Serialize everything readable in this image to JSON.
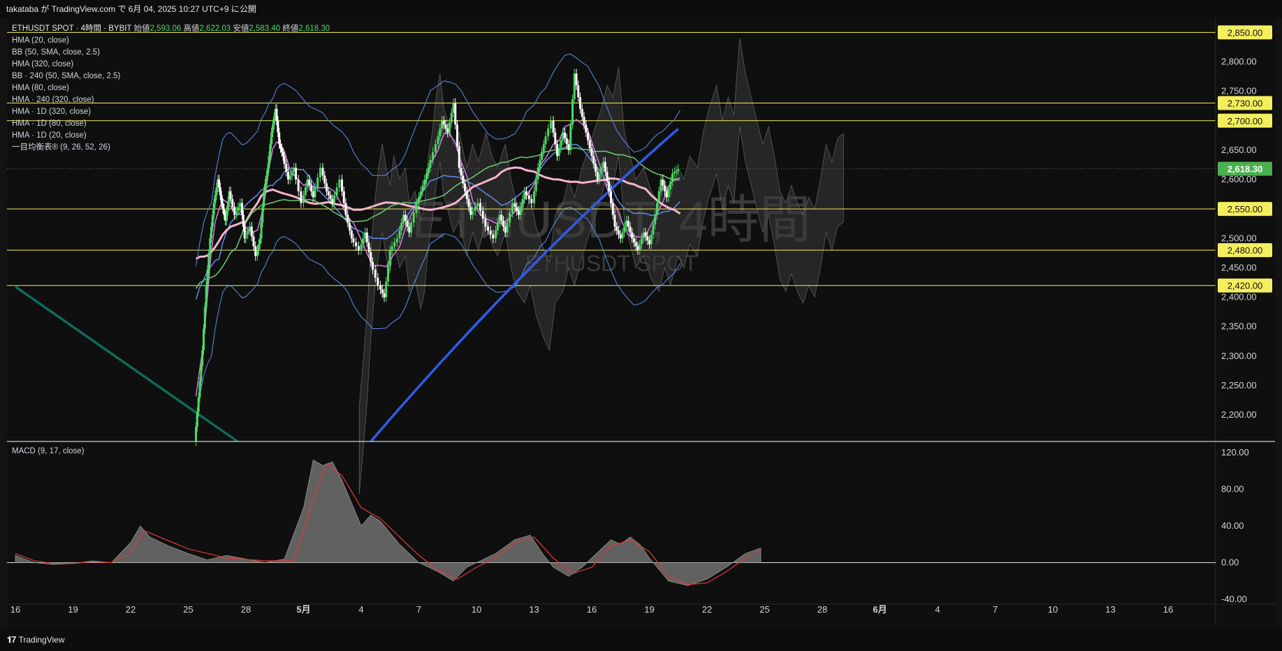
{
  "header": {
    "publish_line": "takataba が TradingView.com で 6月 04, 2025 10:27 UTC+9 に公開"
  },
  "legend": {
    "symbol": "ETHUSDT SPOT · 4時間 · BYBIT",
    "ohlc": [
      {
        "k": "始値",
        "v": "2,593.06"
      },
      {
        "k": "高値",
        "v": "2,622.03"
      },
      {
        "k": "安値",
        "v": "2,583.40"
      },
      {
        "k": "終値",
        "v": "2,618.30"
      }
    ],
    "indicators": [
      "HMA (20, close)",
      "BB (50, SMA, close, 2.5)",
      "HMA (320, close)",
      "BB · 240 (50, SMA, close, 2.5)",
      "HMA (80, close)",
      "HMA · 240 (320, close)",
      "HMA · 1D (320, close)",
      "HMA · 1D (80, close)",
      "HMA · 1D (20, close)",
      "一目均衡表® (9, 26, 52, 26)"
    ]
  },
  "watermark": {
    "line1": "ETHUSDT, 4時間",
    "line2": "ETHUSDT SPOT"
  },
  "macd_label": "MACD (9, 17, close)",
  "footer": {
    "brand": "TradingView",
    "logo": "TV-logo-icon"
  },
  "colors": {
    "bg": "#131313",
    "up": "#4cd964",
    "down": "#ffffff",
    "hline": "#f3ee5e",
    "price_tag": "#4caf50",
    "hma_pink": "#f7b4cf",
    "hma_blue": "#2f5ce6",
    "bb_blue": "#5b8ee6",
    "hma_magenta": "#d978e6",
    "bb_green": "#6fcc72",
    "cloud": "#3a3a3a",
    "macd_fill": "#707070",
    "macd_signal": "#e03a3a"
  },
  "chart_data": [
    {
      "type": "candlestick",
      "symbol": "ETHUSDT SPOT",
      "interval": "4時間",
      "exchange": "BYBIT",
      "y_axis_ticks": [
        "2,800.00",
        "2,750.00",
        "2,650.00",
        "2,600.00",
        "2,500.00",
        "2,450.00",
        "2,400.00",
        "2,350.00",
        "2,300.00",
        "2,250.00",
        "2,200.00"
      ],
      "ylim": [
        2155,
        2873
      ],
      "x_axis_ticks": [
        "16",
        "19",
        "22",
        "25",
        "28",
        "5月",
        "4",
        "7",
        "10",
        "13",
        "16",
        "19",
        "22",
        "25",
        "28",
        "6月",
        "4",
        "7",
        "10",
        "13",
        "16"
      ],
      "horizontal_levels": [
        "2,850.00",
        "2,730.00",
        "2,700.00",
        "2,550.00",
        "2,480.00",
        "2,420.00"
      ],
      "last_price": "2,618.30",
      "ohlc_last": {
        "open": 2593.06,
        "high": 2622.03,
        "low": 2583.4,
        "close": 2618.3
      },
      "price_path": [
        [
          9.4,
          2155
        ],
        [
          9.6,
          2230
        ],
        [
          9.8,
          2310
        ],
        [
          10.0,
          2420
        ],
        [
          10.2,
          2500
        ],
        [
          10.4,
          2560
        ],
        [
          10.6,
          2600
        ],
        [
          10.8,
          2560
        ],
        [
          11.0,
          2530
        ],
        [
          11.2,
          2580
        ],
        [
          11.5,
          2540
        ],
        [
          11.8,
          2560
        ],
        [
          12.0,
          2500
        ],
        [
          12.3,
          2520
        ],
        [
          12.6,
          2470
        ],
        [
          12.8,
          2500
        ],
        [
          13.0,
          2580
        ],
        [
          13.2,
          2620
        ],
        [
          13.4,
          2680
        ],
        [
          13.6,
          2720
        ],
        [
          13.8,
          2660
        ],
        [
          14.0,
          2640
        ],
        [
          14.3,
          2600
        ],
        [
          14.6,
          2620
        ],
        [
          15.0,
          2560
        ],
        [
          15.3,
          2600
        ],
        [
          15.6,
          2570
        ],
        [
          16.0,
          2620
        ],
        [
          16.3,
          2580
        ],
        [
          16.6,
          2560
        ],
        [
          17.0,
          2600
        ],
        [
          17.3,
          2540
        ],
        [
          17.6,
          2500
        ],
        [
          18.0,
          2480
        ],
        [
          18.3,
          2510
        ],
        [
          18.6,
          2460
        ],
        [
          19.0,
          2420
        ],
        [
          19.3,
          2400
        ],
        [
          19.6,
          2480
        ],
        [
          20.0,
          2500
        ],
        [
          20.3,
          2540
        ],
        [
          20.6,
          2510
        ],
        [
          21.0,
          2560
        ],
        [
          21.3,
          2590
        ],
        [
          21.6,
          2620
        ],
        [
          22.0,
          2660
        ],
        [
          22.3,
          2700
        ],
        [
          22.6,
          2680
        ],
        [
          22.9,
          2730
        ],
        [
          23.2,
          2620
        ],
        [
          23.5,
          2580
        ],
        [
          23.8,
          2540
        ],
        [
          24.2,
          2560
        ],
        [
          24.6,
          2520
        ],
        [
          25.0,
          2500
        ],
        [
          25.3,
          2540
        ],
        [
          25.6,
          2510
        ],
        [
          26.0,
          2560
        ],
        [
          26.3,
          2540
        ],
        [
          26.6,
          2580
        ],
        [
          27.0,
          2560
        ],
        [
          27.3,
          2620
        ],
        [
          27.6,
          2660
        ],
        [
          28.0,
          2700
        ],
        [
          28.3,
          2640
        ],
        [
          28.6,
          2680
        ],
        [
          28.9,
          2650
        ],
        [
          29.2,
          2780
        ],
        [
          29.5,
          2720
        ],
        [
          29.8,
          2680
        ],
        [
          30.1,
          2640
        ],
        [
          30.4,
          2600
        ],
        [
          30.7,
          2630
        ],
        [
          31.0,
          2580
        ],
        [
          31.3,
          2520
        ],
        [
          31.6,
          2500
        ],
        [
          31.9,
          2530
        ],
        [
          32.2,
          2500
        ],
        [
          32.5,
          2480
        ],
        [
          32.8,
          2510
        ],
        [
          33.1,
          2490
        ],
        [
          33.4,
          2540
        ],
        [
          33.7,
          2600
        ],
        [
          34.0,
          2570
        ],
        [
          34.3,
          2610
        ],
        [
          34.6,
          2618
        ]
      ]
    },
    {
      "type": "area",
      "name": "MACD (9, 17, close)",
      "y_axis_ticks": [
        "120.00",
        "80.00",
        "40.00",
        "0.00",
        "-40.00"
      ],
      "ylim": [
        -40,
        120
      ],
      "histogram_path": [
        [
          -6,
          8
        ],
        [
          -5,
          0
        ],
        [
          -4,
          -2
        ],
        [
          -3,
          -1
        ],
        [
          -2,
          2
        ],
        [
          -1,
          0
        ],
        [
          0,
          22
        ],
        [
          0.5,
          40
        ],
        [
          1,
          28
        ],
        [
          2,
          18
        ],
        [
          3,
          10
        ],
        [
          4,
          3
        ],
        [
          5,
          8
        ],
        [
          6,
          4
        ],
        [
          7,
          0
        ],
        [
          8,
          4
        ],
        [
          9,
          60
        ],
        [
          9.5,
          112
        ],
        [
          10,
          106
        ],
        [
          10.5,
          110
        ],
        [
          11,
          90
        ],
        [
          12,
          40
        ],
        [
          12.5,
          52
        ],
        [
          13,
          45
        ],
        [
          14,
          20
        ],
        [
          15,
          0
        ],
        [
          16,
          -10
        ],
        [
          16.8,
          -20
        ],
        [
          17.5,
          -5
        ],
        [
          18,
          0
        ],
        [
          19,
          10
        ],
        [
          20,
          25
        ],
        [
          20.8,
          30
        ],
        [
          21.5,
          8
        ],
        [
          22,
          -5
        ],
        [
          22.8,
          -15
        ],
        [
          23.5,
          -5
        ],
        [
          24,
          5
        ],
        [
          25,
          25
        ],
        [
          25.5,
          20
        ],
        [
          26,
          28
        ],
        [
          26.5,
          20
        ],
        [
          27,
          5
        ],
        [
          28,
          -20
        ],
        [
          29,
          -25
        ],
        [
          30,
          -18
        ],
        [
          31,
          -5
        ],
        [
          32,
          10
        ],
        [
          32.8,
          16
        ]
      ],
      "signal_path": [
        [
          -6,
          10
        ],
        [
          -5,
          2
        ],
        [
          -4,
          -1
        ],
        [
          -3,
          -1
        ],
        [
          -2,
          1
        ],
        [
          -1,
          0
        ],
        [
          0,
          10
        ],
        [
          0.7,
          35
        ],
        [
          1.5,
          28
        ],
        [
          3,
          15
        ],
        [
          5,
          5
        ],
        [
          7,
          2
        ],
        [
          8.5,
          2
        ],
        [
          9.5,
          70
        ],
        [
          10.2,
          108
        ],
        [
          11,
          95
        ],
        [
          12,
          60
        ],
        [
          13,
          48
        ],
        [
          14,
          28
        ],
        [
          15,
          8
        ],
        [
          16,
          -8
        ],
        [
          17,
          -18
        ],
        [
          18,
          -5
        ],
        [
          19,
          5
        ],
        [
          20,
          22
        ],
        [
          21,
          28
        ],
        [
          22,
          5
        ],
        [
          23,
          -12
        ],
        [
          24,
          -5
        ],
        [
          25,
          18
        ],
        [
          26,
          25
        ],
        [
          27,
          12
        ],
        [
          28,
          -15
        ],
        [
          29,
          -24
        ],
        [
          30,
          -22
        ],
        [
          31,
          -10
        ],
        [
          32,
          5
        ],
        [
          32.8,
          14
        ]
      ]
    }
  ]
}
